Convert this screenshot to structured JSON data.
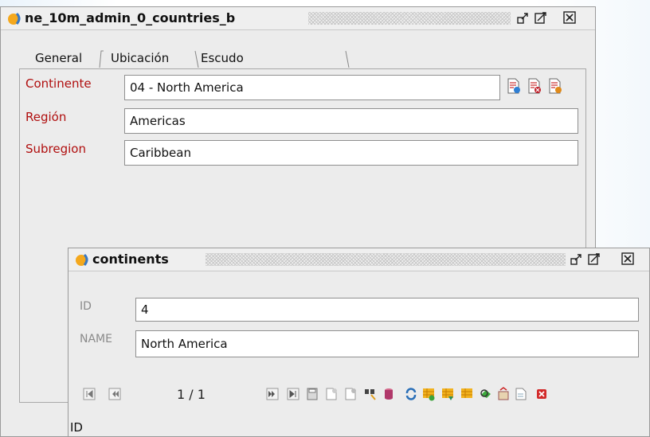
{
  "main_window": {
    "title": "ne_10m_admin_0_countries_b",
    "tabs": [
      {
        "label": "General"
      },
      {
        "label": "Ubicación"
      },
      {
        "label": "Escudo de armas"
      }
    ],
    "fields": [
      {
        "label": "Continente",
        "value": "04 - North America"
      },
      {
        "label": "Región",
        "value": "Americas"
      },
      {
        "label": "Subregion",
        "value": "Caribbean"
      }
    ]
  },
  "sub_window": {
    "title": "continents",
    "fields": [
      {
        "label": "ID",
        "value": "4"
      },
      {
        "label": "NAME",
        "value": "North America"
      }
    ],
    "record_counter": "1 / 1",
    "status_text": "ID"
  },
  "colors": {
    "label_red": "#b00e0e",
    "label_gray": "#8a8a8a",
    "window_bg": "#ececec"
  }
}
